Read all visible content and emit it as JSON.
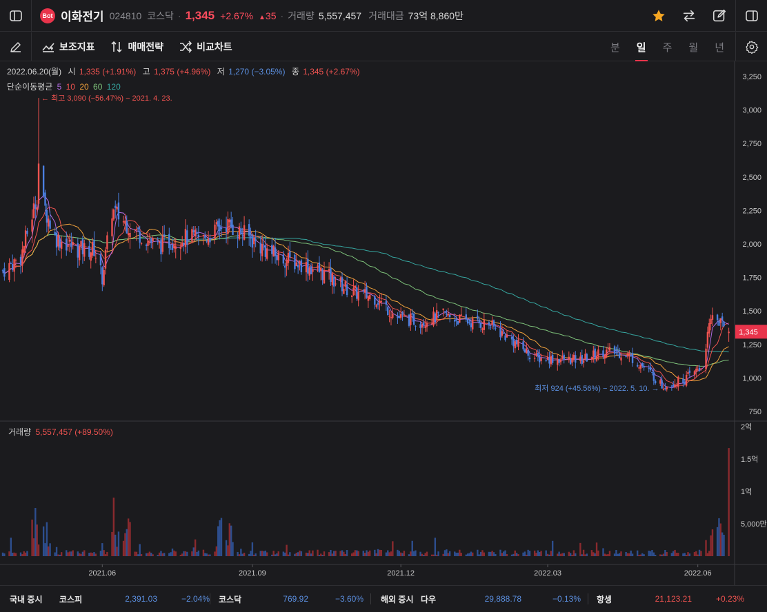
{
  "header": {
    "logo_text": "Bot",
    "name": "이화전기",
    "code": "024810",
    "market": "코스닥",
    "price": "1,345",
    "change_pct": "+2.67%",
    "change_abs": "35",
    "volume_label": "거래량",
    "volume_value": "5,557,457",
    "amount_label": "거래대금",
    "amount_value": "73억 8,860만"
  },
  "toolbar": {
    "indicators_label": "보조지표",
    "strategy_label": "매매전략",
    "compare_label": "비교차트",
    "periods": [
      "분",
      "일",
      "주",
      "월",
      "년"
    ],
    "active_period": "일"
  },
  "ohlc": {
    "date": "2022.06.20(월)",
    "open_label": "시",
    "open_value": "1,335 (+1.91%)",
    "high_label": "고",
    "high_value": "1,375 (+4.96%)",
    "low_label": "저",
    "low_value": "1,270 (−3.05%)",
    "close_label": "종",
    "close_value": "1,345 (+2.67%)"
  },
  "ma": {
    "label": "단순이동평균",
    "periods": [
      {
        "value": "5",
        "color": "#b06be0"
      },
      {
        "value": "10",
        "color": "#ef5350"
      },
      {
        "value": "20",
        "color": "#f0a13c"
      },
      {
        "value": "60",
        "color": "#7ec27a"
      },
      {
        "value": "120",
        "color": "#36a6a0"
      }
    ]
  },
  "annotations": {
    "high": "← 최고 3,090 (−56.47%) − 2021. 4. 23.",
    "low": "최저 924 (+45.56%) − 2022. 5. 10. →"
  },
  "volume": {
    "label": "거래량",
    "value": "5,557,457 (+89.50%)"
  },
  "chart_data": {
    "type": "candlestick",
    "price_axis": [
      "3,250",
      "3,000",
      "2,750",
      "2,500",
      "2,250",
      "2,000",
      "1,750",
      "1,500",
      "1,250",
      "1,000",
      "750"
    ],
    "price_ticks": [
      3250,
      3000,
      2750,
      2500,
      2250,
      2000,
      1750,
      1500,
      1250,
      1000,
      750
    ],
    "volume_axis": [
      "2억",
      "1.5억",
      "1억",
      "5,000만"
    ],
    "volume_ticks": [
      200000000,
      150000000,
      100000000,
      50000000
    ],
    "x_axis": [
      "2021.06",
      "2021.09",
      "2021.12",
      "2022.03",
      "2022.06"
    ],
    "current_price_label": "1,345",
    "current_price": 1345,
    "close_path": [
      [
        "2021-04-01",
        1800
      ],
      [
        "2021-04-12",
        1900
      ],
      [
        "2021-04-23",
        2400
      ],
      [
        "2021-05-03",
        2050
      ],
      [
        "2021-05-17",
        1960
      ],
      [
        "2021-05-27",
        1960
      ],
      [
        "2021-06-01",
        1750
      ],
      [
        "2021-06-07",
        2250
      ],
      [
        "2021-06-21",
        2100
      ],
      [
        "2021-07-05",
        1980
      ],
      [
        "2021-07-19",
        2050
      ],
      [
        "2021-08-02",
        2040
      ],
      [
        "2021-08-16",
        2150
      ],
      [
        "2021-08-30",
        2050
      ],
      [
        "2021-09-06",
        1980
      ],
      [
        "2021-09-17",
        1900
      ],
      [
        "2021-10-01",
        1850
      ],
      [
        "2021-10-15",
        1780
      ],
      [
        "2021-11-01",
        1640
      ],
      [
        "2021-11-15",
        1600
      ],
      [
        "2021-11-29",
        1450
      ],
      [
        "2021-12-13",
        1420
      ],
      [
        "2021-12-27",
        1470
      ],
      [
        "2022-01-10",
        1420
      ],
      [
        "2022-01-24",
        1400
      ],
      [
        "2022-02-07",
        1280
      ],
      [
        "2022-02-21",
        1150
      ],
      [
        "2022-03-07",
        1140
      ],
      [
        "2022-03-21",
        1130
      ],
      [
        "2022-04-04",
        1200
      ],
      [
        "2022-04-18",
        1180
      ],
      [
        "2022-05-02",
        1050
      ],
      [
        "2022-05-10",
        940
      ],
      [
        "2022-05-24",
        990
      ],
      [
        "2022-06-03",
        1080
      ],
      [
        "2022-06-10",
        1480
      ],
      [
        "2022-06-20",
        1345
      ]
    ],
    "events": {
      "high": {
        "date": "2021-04-23",
        "value": 3090
      },
      "low": {
        "date": "2022-05-10",
        "value": 924
      }
    }
  },
  "indices": {
    "domestic_title": "국내 증시",
    "foreign_title": "해외 증시",
    "items": [
      {
        "name": "코스피",
        "value": "2,391.03",
        "change": "−2.04%",
        "dir": "down"
      },
      {
        "name": "코스닥",
        "value": "769.92",
        "change": "−3.60%",
        "dir": "down"
      },
      {
        "name": "다우",
        "value": "29,888.78",
        "change": "−0.13%",
        "dir": "down"
      },
      {
        "name": "항셍",
        "value": "21,123.21",
        "change": "+0.23%",
        "dir": "up"
      }
    ]
  }
}
